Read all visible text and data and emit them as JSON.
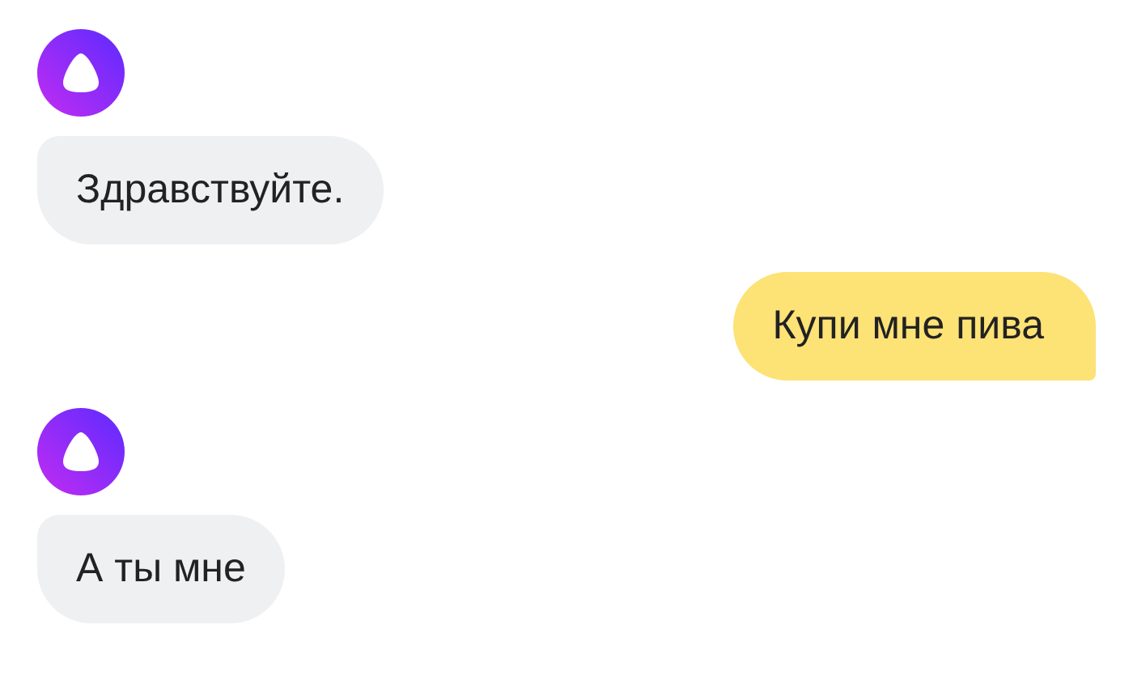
{
  "messages": [
    {
      "kind": "assistant",
      "text": "Здравствуйте."
    },
    {
      "kind": "user",
      "text": "Купи мне пива"
    },
    {
      "kind": "assistant",
      "text": "А ты мне"
    }
  ]
}
